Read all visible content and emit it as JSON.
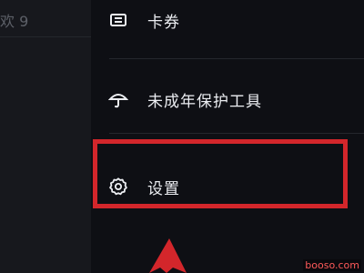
{
  "background": {
    "text": "欢 9"
  },
  "menu": {
    "items": [
      {
        "icon": "ticket-icon",
        "label": "卡券"
      },
      {
        "icon": "umbrella-icon",
        "label": "未成年保护工具"
      },
      {
        "icon": "gear-icon",
        "label": "设置"
      }
    ]
  },
  "annotation": {
    "highlight_color": "#d3262b",
    "target": "设置"
  },
  "watermark": {
    "text": "booso.com"
  }
}
